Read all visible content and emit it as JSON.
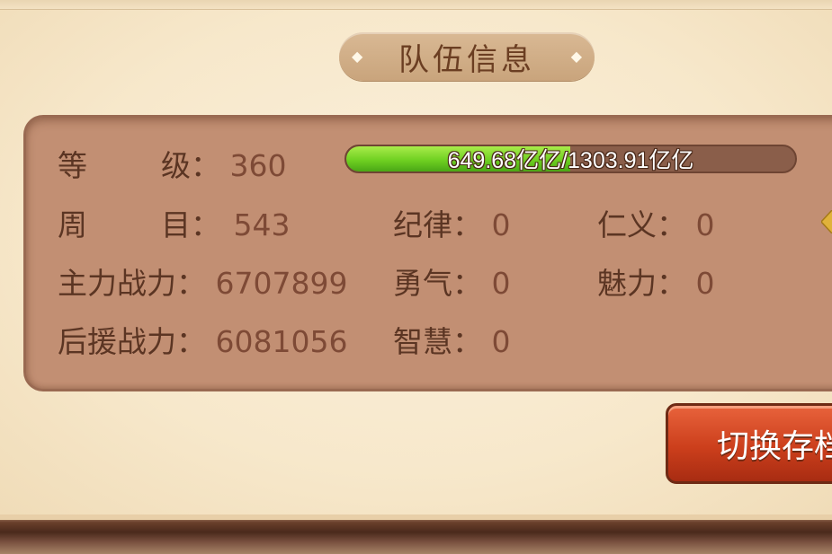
{
  "panel_title": "队伍信息",
  "stats": {
    "level": {
      "label": "等级：",
      "label_chars": [
        "等",
        "级"
      ],
      "colon": "：",
      "value": "360"
    },
    "cycle": {
      "label": "周目：",
      "label_chars": [
        "周",
        "目"
      ],
      "colon": "：",
      "value": "543"
    },
    "main_power": {
      "label": "主力战力：",
      "value": "6707899"
    },
    "support_power": {
      "label": "后援战力：",
      "value": "6081056"
    },
    "discipline": {
      "label": "纪律：",
      "value": "0"
    },
    "courage": {
      "label": "勇气：",
      "value": "0"
    },
    "wisdom": {
      "label": "智慧：",
      "value": "0"
    },
    "benevolence": {
      "label": "仁义：",
      "value": "0"
    },
    "charisma": {
      "label": "魅力：",
      "value": "0"
    }
  },
  "experience": {
    "text": "649.68亿亿/1303.91亿亿",
    "fraction": 0.498
  },
  "switch_button": {
    "label": "切换存档"
  },
  "icons": {
    "title_left": "diamond-ornament",
    "title_right": "diamond-ornament",
    "side_arrow": "gold-arrow-icon"
  },
  "colors": {
    "panel": "#c28f73",
    "button": "#cc3f1c",
    "exp_fill": "#6fd021"
  }
}
